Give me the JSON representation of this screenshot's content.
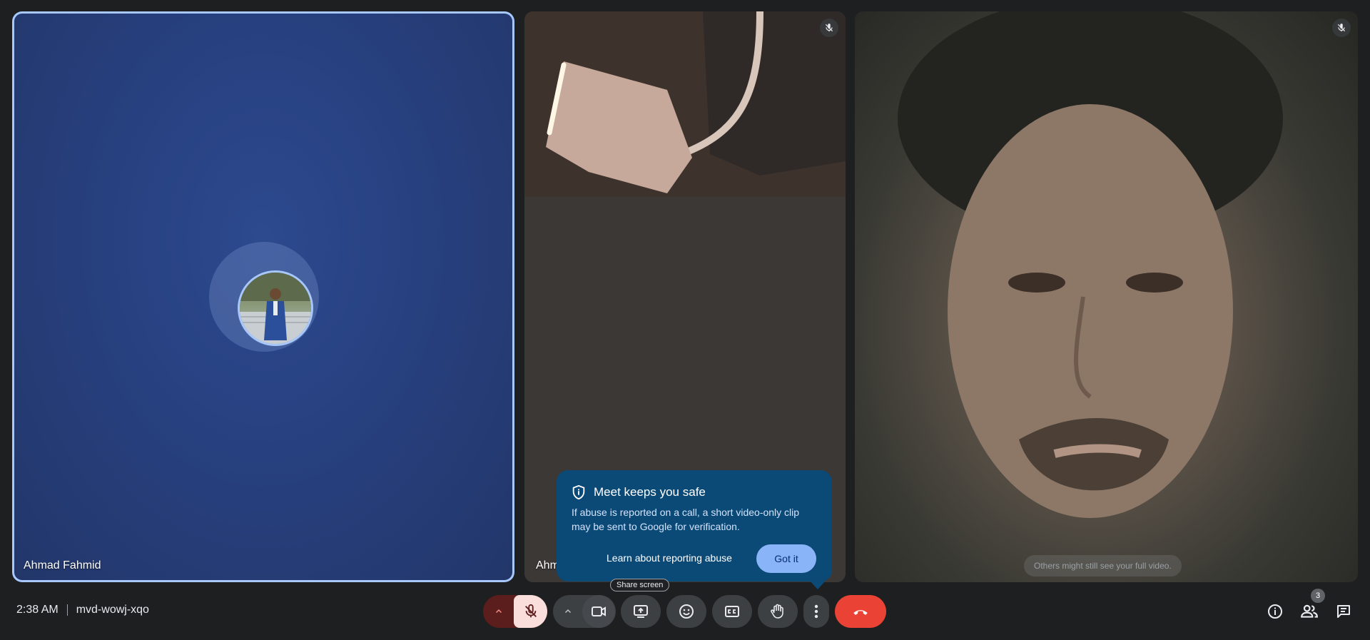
{
  "tiles": [
    {
      "name": "Ahmad Fahmid"
    },
    {
      "name": "Ahm"
    },
    {
      "note": "Others might still see your full video."
    }
  ],
  "safety_popup": {
    "title": "Meet keeps you safe",
    "body": "If abuse is reported on a call, a short video-only clip may be sent to Google for verification.",
    "link": "Learn about reporting abuse",
    "button": "Got it"
  },
  "tooltip": "Share screen",
  "footer": {
    "time": "2:38 AM",
    "meeting_code": "mvd-wowj-xqo",
    "participant_count": "3"
  },
  "colors": {
    "accent": "#a8c7fa",
    "end_call": "#ea4335",
    "popup_bg": "#0b4a77",
    "mic_muted_bg": "#f9dedc"
  }
}
